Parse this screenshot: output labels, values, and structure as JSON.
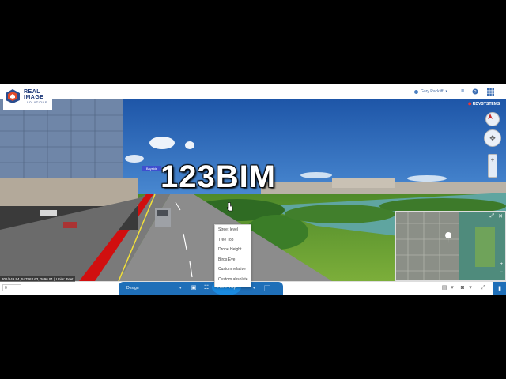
{
  "logo": {
    "line1": "REAL",
    "line2": "IMAGE",
    "line3": "SOLUTIONS"
  },
  "header": {
    "user_name": "Gary Rackliff",
    "icons": [
      "user-icon",
      "list-icon",
      "help-icon",
      "grid-menu-icon"
    ]
  },
  "viewport": {
    "brand_prefix": "⬢ ",
    "brand": "RDVSYSTEMS",
    "watermark": "123BIM",
    "road_sign": "Bayside"
  },
  "view_menu": {
    "options": [
      "Street level",
      "Tree Top",
      "Drone Height",
      "Birds Eye",
      "Custom relative",
      "Custom absolute"
    ],
    "selected": "Tree Top"
  },
  "bottombar": {
    "coord_value": "0",
    "coords_readout": "301/649.94, 547863.63, 2696.91 | Units: Feet",
    "toolbar_label": "Design"
  },
  "colors": {
    "toolbar_blue": "#1f6fb8",
    "active_view_blue": "#1a8ae0",
    "sky": "#2c63b2",
    "bus_lane": "#d10f0f"
  }
}
